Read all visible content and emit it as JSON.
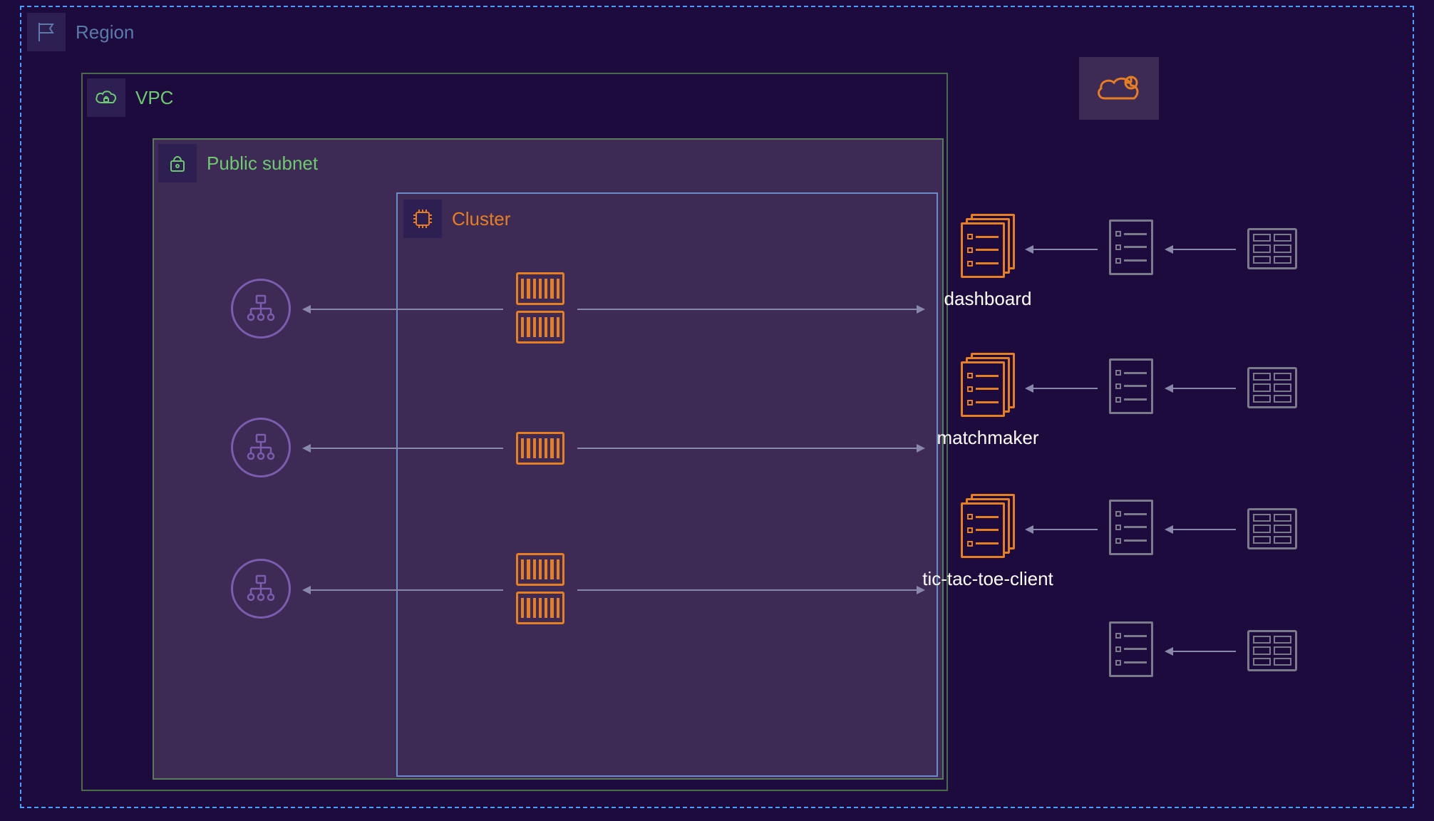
{
  "region": {
    "label": "Region"
  },
  "vpc": {
    "label": "VPC"
  },
  "subnet": {
    "label": "Public subnet"
  },
  "cluster": {
    "label": "Cluster"
  },
  "services": [
    {
      "name": "dashboard"
    },
    {
      "name": "matchmaker"
    },
    {
      "name": "tic-tac-toe-client"
    }
  ]
}
